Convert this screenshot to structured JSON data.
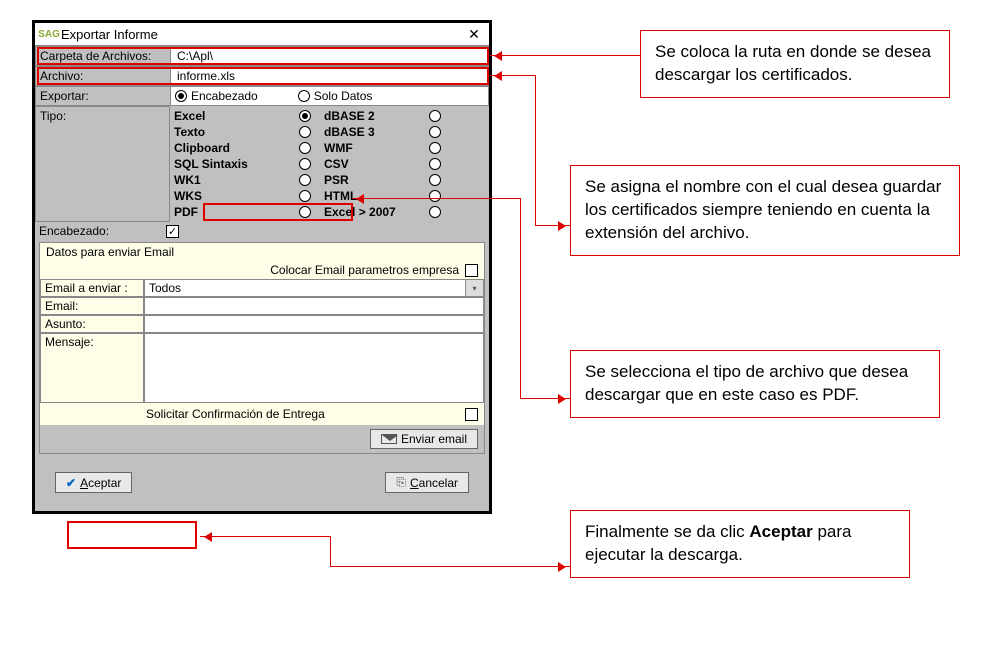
{
  "window": {
    "title": "Exportar Informe",
    "icon_text": "SAG"
  },
  "fields": {
    "carpeta_label": "Carpeta de Archivos:",
    "carpeta_value": "C:\\Apl\\",
    "archivo_label": "Archivo:",
    "archivo_value": "informe.xls",
    "exportar_label": "Exportar:",
    "tipo_label": "Tipo:",
    "encabezado_label": "Encabezado:"
  },
  "export_options": {
    "encabezado": "Encabezado",
    "solo_datos": "Solo Datos",
    "selected": "encabezado"
  },
  "tipo_options": {
    "col1": [
      "Excel",
      "Texto",
      "Clipboard",
      "SQL Sintaxis",
      "WK1",
      "WKS",
      "PDF"
    ],
    "col2": [
      "dBASE 2",
      "dBASE 3",
      "WMF",
      "CSV",
      "PSR",
      "HTML",
      "Excel > 2007"
    ],
    "selected": "Excel"
  },
  "encabezado_checked": true,
  "email": {
    "legend": "Datos para enviar Email",
    "param_label": "Colocar Email parametros empresa",
    "enviar_label": "Email a enviar :",
    "enviar_value": "Todos",
    "email_label": "Email:",
    "email_value": "",
    "asunto_label": "Asunto:",
    "asunto_value": "",
    "mensaje_label": "Mensaje:",
    "mensaje_value": "",
    "confirm_label": "Solicitar Confirmación de Entrega",
    "send_label": "Enviar email"
  },
  "buttons": {
    "aceptar": "Aceptar",
    "cancelar": "Cancelar"
  },
  "callouts": {
    "c1": "Se coloca la ruta en donde se desea descargar los certificados.",
    "c2": "Se asigna el nombre con el cual desea guardar los certificados siempre teniendo en cuenta la extensión del archivo.",
    "c3": "Se selecciona el tipo de archivo que desea descargar que en este caso es PDF.",
    "c4_pre": "Finalmente se da clic ",
    "c4_bold": "Aceptar",
    "c4_post": " para ejecutar la descarga."
  }
}
